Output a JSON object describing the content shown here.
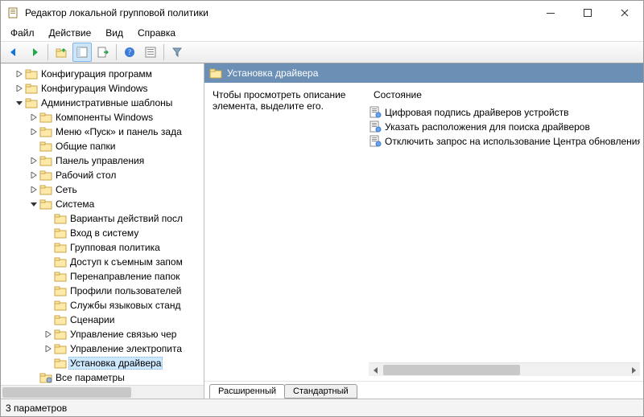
{
  "window": {
    "title": "Редактор локальной групповой политики"
  },
  "menu": {
    "file": "Файл",
    "action": "Действие",
    "view": "Вид",
    "help": "Справка"
  },
  "tree": {
    "n0": "Конфигурация программ",
    "n1": "Конфигурация Windows",
    "n2": "Административные шаблоны",
    "n2_0": "Компоненты Windows",
    "n2_1": "Меню «Пуск» и панель зада",
    "n2_2": "Общие папки",
    "n2_3": "Панель управления",
    "n2_4": "Рабочий стол",
    "n2_5": "Сеть",
    "n2_6": "Система",
    "n2_6_0": "Варианты действий посл",
    "n2_6_1": "Вход в систему",
    "n2_6_2": "Групповая политика",
    "n2_6_3": "Доступ к съемным запом",
    "n2_6_4": "Перенаправление папок",
    "n2_6_5": "Профили пользователей",
    "n2_6_6": "Службы языковых станд",
    "n2_6_7": "Сценарии",
    "n2_6_8": "Управление связью чер",
    "n2_6_9": "Управление электропита",
    "n2_6_10": "Установка драйвера",
    "n2_all": "Все параметры"
  },
  "right": {
    "header": "Установка драйвера",
    "description": "Чтобы просмотреть описание элемента, выделите его.",
    "column": "Состояние",
    "items": {
      "i0": "Цифровая подпись драйверов устройств",
      "i1": "Указать расположения для поиска драйверов",
      "i2": "Отключить запрос на использование Центра обновления"
    },
    "tabs": {
      "extended": "Расширенный",
      "standard": "Стандартный"
    }
  },
  "status": "3 параметров"
}
